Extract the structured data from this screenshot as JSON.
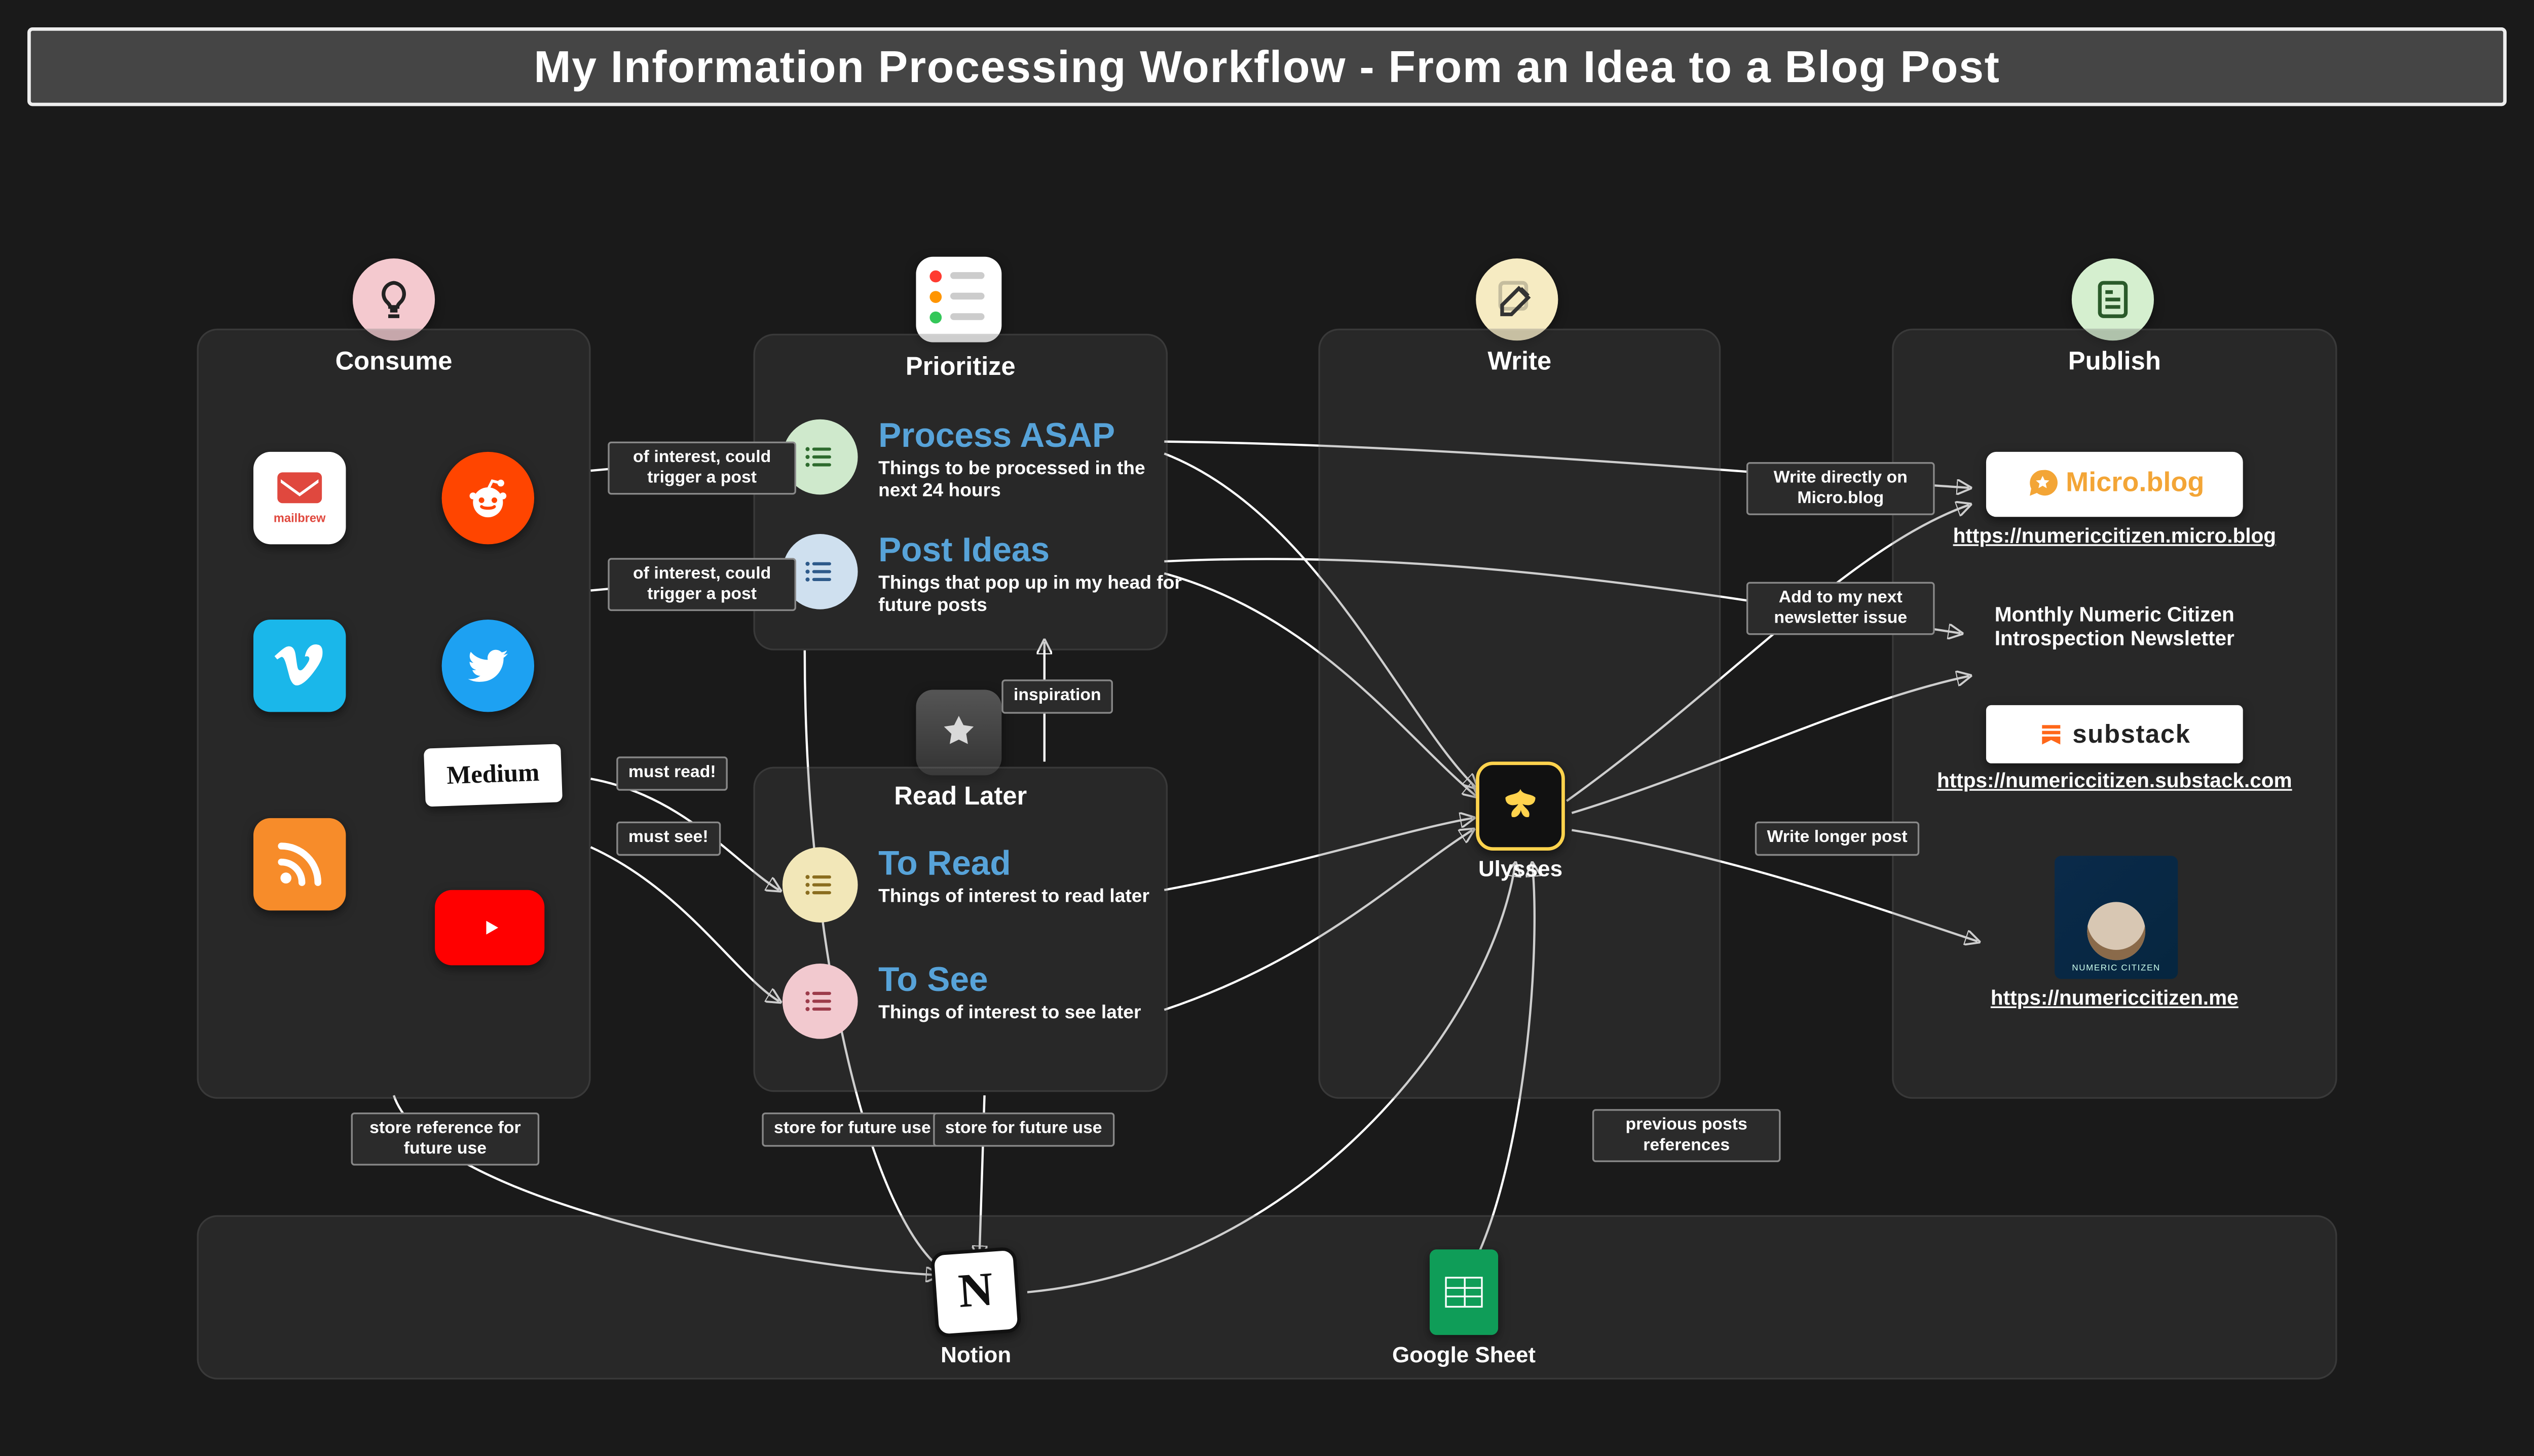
{
  "title": "My Information Processing Workflow - From an Idea to a Blog Post",
  "columns": {
    "consume": {
      "label": "Consume"
    },
    "prioritize": {
      "label": "Prioritize"
    },
    "read_later": {
      "label": "Read Later"
    },
    "write": {
      "label": "Write"
    },
    "publish": {
      "label": "Publish"
    }
  },
  "consume_apps": {
    "mailbrew": "mailbrew",
    "reddit": "reddit",
    "vimeo": "Vimeo",
    "twitter": "Twitter",
    "medium": "Medium",
    "rss": "RSS",
    "youtube": "YouTube"
  },
  "prioritize": {
    "process_asap": {
      "title": "Process ASAP",
      "sub": "Things to be processed in the next 24 hours"
    },
    "post_ideas": {
      "title": "Post Ideas",
      "sub": "Things that pop up in my head for future posts"
    }
  },
  "read_later": {
    "to_read": {
      "title": "To Read",
      "sub": "Things of interest to read later"
    },
    "to_see": {
      "title": "To See",
      "sub": "Things of interest to see later"
    }
  },
  "write": {
    "ulysses": "Ulysses"
  },
  "publish": {
    "microblog_label": "Micro.blog",
    "microblog_url": "https://numericcitizen.micro.blog",
    "newsletter_title": "Monthly Numeric Citizen Introspection Newsletter",
    "substack_label": "substack",
    "substack_url": "https://numericcitizen.substack.com",
    "me_caption": "NUMERIC CITIZEN",
    "me_url": "https://numericcitizen.me"
  },
  "storage": {
    "notion": "Notion",
    "gsheet": "Google Sheet"
  },
  "edges": {
    "interest_trigger_1": "of interest, could trigger a post",
    "interest_trigger_2": "of interest, could trigger a post",
    "must_read": "must read!",
    "must_see": "must see!",
    "inspiration": "inspiration",
    "store_reference": "store reference for future use",
    "store_future_1": "store for future use",
    "store_future_2": "store for future use",
    "prev_refs": "previous posts references",
    "write_microblog": "Write directly on Micro.blog",
    "add_newsletter": "Add to my next newsletter issue",
    "write_longer": "Write longer post"
  }
}
